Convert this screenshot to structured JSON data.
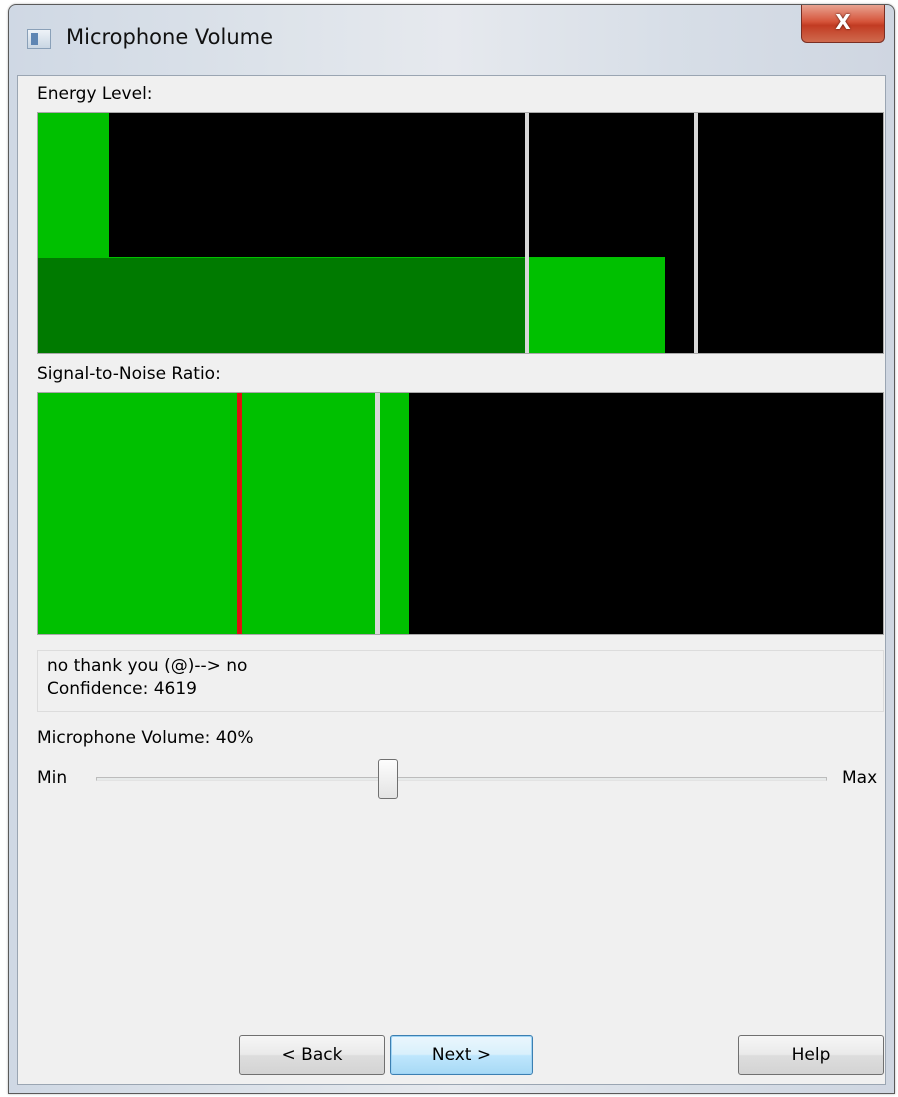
{
  "window": {
    "title": "Microphone Volume",
    "close_glyph": "X"
  },
  "energy": {
    "label": "Energy Level:",
    "colors": {
      "bright": "#00c000",
      "dark": "#007a00",
      "marker": "#d8d8d8",
      "background": "#000000"
    }
  },
  "snr": {
    "label": "Signal-to-Noise Ratio:",
    "colors": {
      "fill": "#00c000",
      "threshold": "#e01010",
      "marker": "#d8d8d8",
      "background": "#000000"
    }
  },
  "recognition": {
    "line1": "no thank you (@)--> no",
    "line2": "Confidence: 4619"
  },
  "volume": {
    "label": "Microphone Volume:  40%",
    "min_label": "Min",
    "max_label": "Max",
    "value_percent": 40
  },
  "buttons": {
    "back": "< Back",
    "next": "Next >",
    "help": "Help"
  }
}
